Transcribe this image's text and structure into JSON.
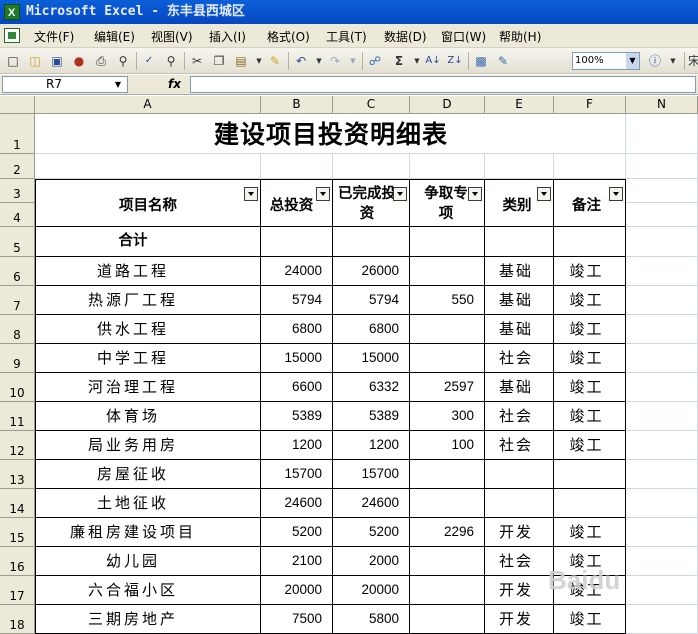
{
  "window": {
    "title": "Microsoft Excel - 东丰县西城区"
  },
  "menu": [
    "文件(F)",
    "编辑(E)",
    "视图(V)",
    "插入(I)",
    "格式(O)",
    "工具(T)",
    "数据(D)",
    "窗口(W)",
    "帮助(H)"
  ],
  "toolbar": {
    "zoom": "100%",
    "overflow_text": "宋"
  },
  "formula_bar": {
    "name_box": "R7",
    "fx_label": "fx",
    "formula": ""
  },
  "columns": [
    "A",
    "B",
    "C",
    "D",
    "E",
    "F",
    "N"
  ],
  "rows": [
    "1",
    "2",
    "3",
    "4",
    "5",
    "6",
    "7",
    "8",
    "9",
    "10",
    "11",
    "12",
    "13",
    "14",
    "15",
    "16",
    "17",
    "18"
  ],
  "sheet": {
    "title": "建设项目投资明细表",
    "headers": {
      "name": "项目名称",
      "total": "总投资",
      "done": "已完成投资",
      "fight": "争取专项",
      "type": "类别",
      "note": "备注"
    },
    "total_row": {
      "name": "合计"
    },
    "items": [
      {
        "name": "道路工程",
        "total": "24000",
        "done": "26000",
        "fight": "",
        "type": "基础",
        "note": "竣工"
      },
      {
        "name": "热源厂工程",
        "total": "5794",
        "done": "5794",
        "fight": "550",
        "type": "基础",
        "note": "竣工"
      },
      {
        "name": "供水工程",
        "total": "6800",
        "done": "6800",
        "fight": "",
        "type": "基础",
        "note": "竣工"
      },
      {
        "name": "中学工程",
        "total": "15000",
        "done": "15000",
        "fight": "",
        "type": "社会",
        "note": "竣工"
      },
      {
        "name": "河治理工程",
        "total": "6600",
        "done": "6332",
        "fight": "2597",
        "type": "基础",
        "note": "竣工"
      },
      {
        "name": "体育场",
        "total": "5389",
        "done": "5389",
        "fight": "300",
        "type": "社会",
        "note": "竣工"
      },
      {
        "name": "局业务用房",
        "total": "1200",
        "done": "1200",
        "fight": "100",
        "type": "社会",
        "note": "竣工"
      },
      {
        "name": "房屋征收",
        "total": "15700",
        "done": "15700",
        "fight": "",
        "type": "",
        "note": ""
      },
      {
        "name": "土地征收",
        "total": "24600",
        "done": "24600",
        "fight": "",
        "type": "",
        "note": ""
      },
      {
        "name": "廉租房建设项目",
        "total": "5200",
        "done": "5200",
        "fight": "2296",
        "type": "开发",
        "note": "竣工"
      },
      {
        "name": "幼儿园",
        "total": "2100",
        "done": "2000",
        "fight": "",
        "type": "社会",
        "note": "竣工"
      },
      {
        "name": "六合福小区",
        "total": "20000",
        "done": "20000",
        "fight": "",
        "type": "开发",
        "note": "竣工"
      },
      {
        "name": "三期房地产",
        "total": "7500",
        "done": "5800",
        "fight": "",
        "type": "开发",
        "note": "竣工"
      }
    ]
  },
  "icons": [
    "new-icon",
    "open-icon",
    "save-icon",
    "permission-icon",
    "print-icon",
    "print-preview-icon",
    "spelling-icon",
    "research-icon",
    "cut-icon",
    "copy-icon",
    "paste-icon",
    "format-painter-icon",
    "undo-icon",
    "redo-icon",
    "hyperlink-icon",
    "autosum-icon",
    "sort-asc-icon",
    "sort-desc-icon",
    "chart-wizard-icon",
    "drawing-icon",
    "help-icon"
  ],
  "watermark": "Baidu"
}
